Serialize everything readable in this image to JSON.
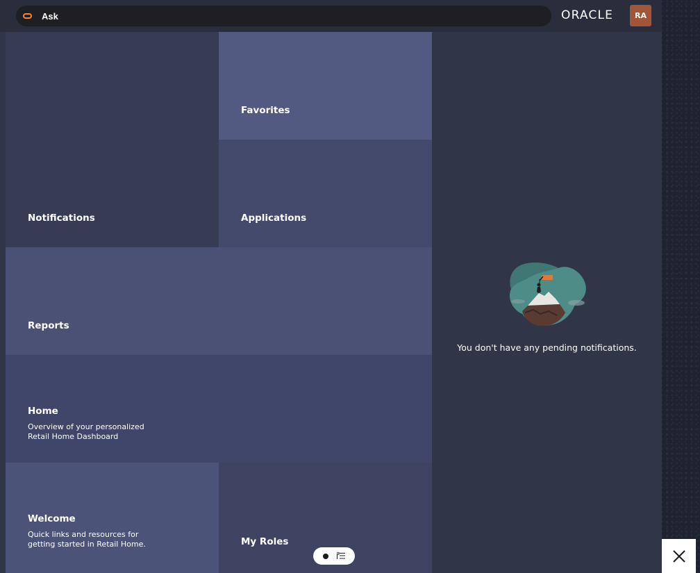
{
  "topbar": {
    "ask_label": "Ask",
    "brand": "ORACLE",
    "avatar_initials": "RA"
  },
  "tiles": {
    "notifications": {
      "title": "Notifications"
    },
    "favorites": {
      "title": "Favorites"
    },
    "applications": {
      "title": "Applications"
    },
    "reports": {
      "title": "Reports"
    },
    "home": {
      "title": "Home",
      "description": "Overview of your personalized\nRetail Home Dashboard"
    },
    "welcome": {
      "title": "Welcome",
      "description": "Quick links and resources for\ngetting started in Retail Home."
    },
    "my_roles": {
      "title": "My Roles"
    }
  },
  "notifications_panel": {
    "empty_message": "You don't have any pending notifications."
  },
  "icons": {
    "ask": "oracle-ring-icon",
    "view_toggle": [
      "dot-icon",
      "list-icon"
    ],
    "close": "close-icon"
  },
  "colors": {
    "accent": "#f08a2c",
    "avatar_bg": "#a25638",
    "favorites_tile": "#525a81"
  }
}
